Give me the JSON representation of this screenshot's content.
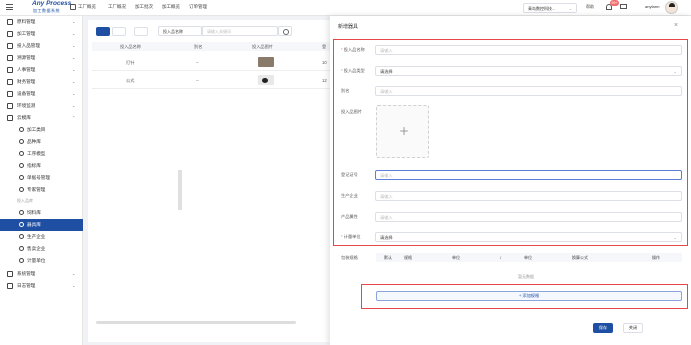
{
  "app": {
    "title": "Any Process",
    "subtitle": "加工数据系统",
    "menu_icon": "hamburger-icon"
  },
  "topnav": {
    "items": [
      "工厂概览",
      "工厂概况",
      "加工批次",
      "加工概览",
      "订单管理"
    ],
    "selector_value": "青岛数控科技...",
    "help_label": "帮助",
    "notification_badge": "99+",
    "username": "anyfarm"
  },
  "sidebar": {
    "items": [
      {
        "label": "原料管理",
        "icon": "scissors-icon"
      },
      {
        "label": "加工管理",
        "icon": "wrench-icon"
      },
      {
        "label": "投入品管理",
        "icon": "box-icon"
      },
      {
        "label": "溯源管理",
        "icon": "trace-icon"
      },
      {
        "label": "人事管理",
        "icon": "user-icon"
      },
      {
        "label": "财务管理",
        "icon": "finance-icon"
      },
      {
        "label": "设备管理",
        "icon": "monitor-icon"
      },
      {
        "label": "环境监测",
        "icon": "env-icon"
      },
      {
        "label": "云模库",
        "icon": "cloud-icon"
      }
    ],
    "sub_items": [
      {
        "label": "加工类目",
        "icon": "gear-icon"
      },
      {
        "label": "品种库",
        "icon": "leaf-icon"
      },
      {
        "label": "工序模型",
        "icon": "flow-icon"
      },
      {
        "label": "指标库",
        "icon": "tag-icon"
      },
      {
        "label": "单据号管理",
        "icon": "clock-icon"
      },
      {
        "label": "专家管理",
        "icon": "users-icon"
      }
    ],
    "group_label": "投入品库",
    "group_items": [
      {
        "label": "饲料库",
        "icon": "circle-icon",
        "active": false
      },
      {
        "label": "器具库",
        "icon": "tool-icon",
        "active": true
      },
      {
        "label": "生产企业",
        "icon": "factory-icon",
        "active": false
      },
      {
        "label": "售卖企业",
        "icon": "cart-icon",
        "active": false
      },
      {
        "label": "计量单位",
        "icon": "scale-icon",
        "active": false
      }
    ],
    "bottom_items": [
      {
        "label": "系统管理",
        "icon": "shield-icon"
      },
      {
        "label": "日志管理",
        "icon": "log-icon"
      }
    ]
  },
  "list": {
    "search_field": "投入品名称",
    "search_placeholder": "请输入关键词",
    "columns": [
      "投入品名称",
      "别名",
      "投入品图片",
      "登"
    ],
    "rows": [
      {
        "name": "打针",
        "alias": "--",
        "extra": "10"
      },
      {
        "name": "公式",
        "alias": "--",
        "extra": "12"
      }
    ]
  },
  "drawer": {
    "title": "新增器具",
    "fields": {
      "name": {
        "label": "投入品名称",
        "placeholder": "请输入"
      },
      "type": {
        "label": "投入品类型",
        "value": "请选择"
      },
      "alias": {
        "label": "别名",
        "placeholder": "请输入"
      },
      "image": {
        "label": "投入品图片"
      },
      "reg_no": {
        "label": "登记证号",
        "placeholder": "请输入"
      },
      "producer": {
        "label": "生产企业",
        "placeholder": "请输入"
      },
      "origin": {
        "label": "产品属性",
        "placeholder": "请输入"
      },
      "unit": {
        "label": "计量单位",
        "value": "请选择"
      }
    },
    "spec": {
      "label": "包装规格",
      "columns": [
        "默认",
        "规格",
        "单位",
        "/",
        "单位",
        "换算公式",
        "操作"
      ],
      "empty_text": "暂无数据",
      "add_label": "+ 添加规格"
    },
    "save_label": "保存",
    "close_label": "关闭"
  },
  "colors": {
    "primary": "#1e4fa3",
    "highlight_border": "#e54848",
    "required": "#f56c6c"
  }
}
